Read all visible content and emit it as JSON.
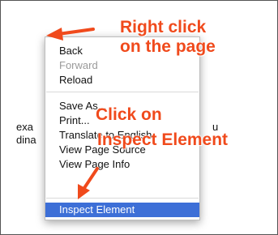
{
  "page": {
    "left_text_line1": "exa",
    "left_text_line2": "dina",
    "right_text": "u"
  },
  "callouts": {
    "right_click_line1": "Right click",
    "right_click_line2": "on the page",
    "click_on": "Click on",
    "inspect_element": "Inspect Element"
  },
  "context_menu": {
    "items": [
      {
        "label": "Back",
        "enabled": true
      },
      {
        "label": "Forward",
        "enabled": false
      },
      {
        "label": "Reload",
        "enabled": true
      },
      {
        "label": "Save As...",
        "enabled": true
      },
      {
        "label": "Print...",
        "enabled": true
      },
      {
        "label": "Translate to English",
        "enabled": true
      },
      {
        "label": "View Page Source",
        "enabled": true
      },
      {
        "label": "View Page Info",
        "enabled": true
      },
      {
        "label": "Inspect Element",
        "enabled": true,
        "highlighted": true
      }
    ]
  },
  "colors": {
    "callout": "#f04a1c",
    "highlight": "#3d6fd7"
  },
  "icons": [
    "arrow-icon"
  ]
}
